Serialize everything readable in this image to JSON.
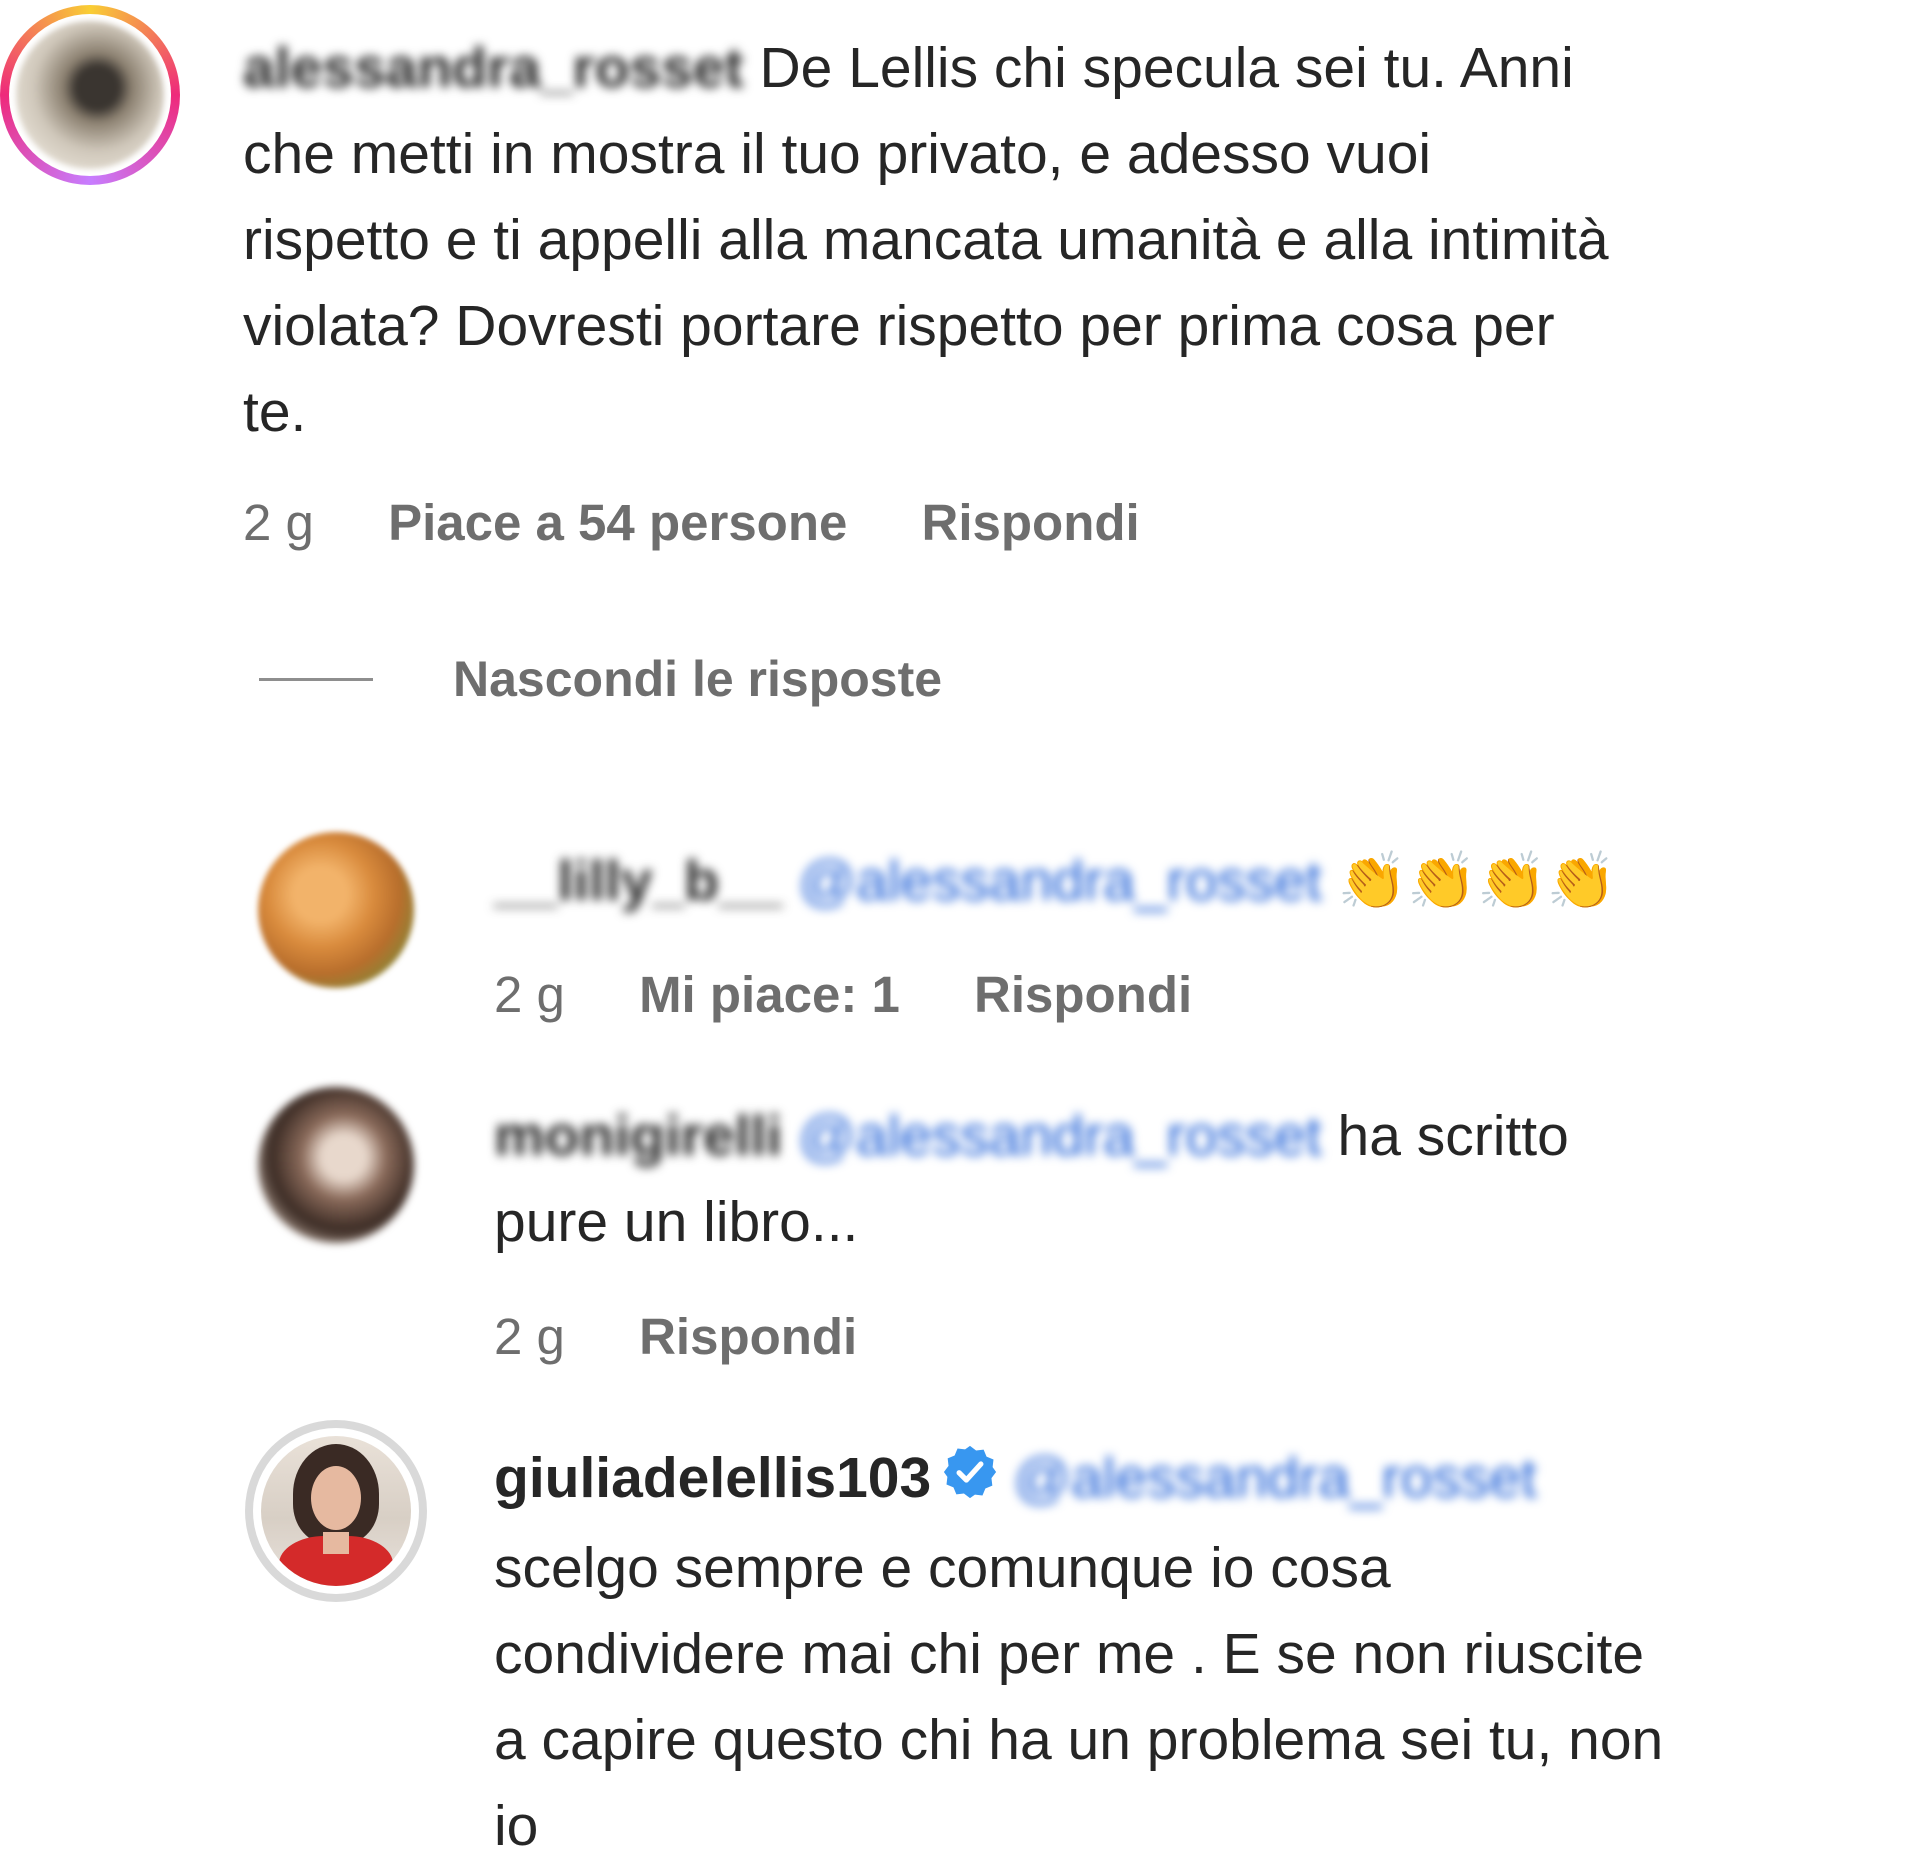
{
  "comment_main": {
    "username": "alessandra_rosset",
    "text_lines": [
      "De Lellis chi specula sei tu. Anni",
      "che metti in mostra il tuo privato, e adesso vuoi",
      "rispetto e ti appelli alla mancata umanità e alla intimità",
      "violata? Dovresti portare rispetto per prima cosa per",
      "te."
    ],
    "time": "2 g",
    "likes": "Piace a 54 persone",
    "reply_label": "Rispondi"
  },
  "replies_toggle": {
    "label": "Nascondi le risposte"
  },
  "reply1": {
    "username": "__lilly_b__",
    "mention": "@alessandra_rosset",
    "emoji": "👏👏👏👏",
    "time": "2 g",
    "likes": "Mi piace: 1",
    "reply_label": "Rispondi"
  },
  "reply2": {
    "username": "monigirelli",
    "mention": "@alessandra_rosset",
    "text_first": "ha scritto",
    "text_second": "pure un libro...",
    "time": "2 g",
    "reply_label": "Rispondi"
  },
  "reply3": {
    "username": "giuliadelellis103",
    "mention": "@alessandra_rosset",
    "text_lines": [
      "scelgo sempre e comunque io cosa",
      "condividere mai chi per me . E se non riuscite",
      "a capire questo chi ha un problema sei tu, non",
      "io"
    ]
  },
  "colors": {
    "text": "#262626",
    "meta": "#6e6e6e",
    "mention": "#1e5fd6",
    "verified": "#3897f0",
    "story_ring_start": "#f9ce34",
    "story_ring_end": "#ee2a7b"
  },
  "icons": {
    "verified": "verified-badge-icon",
    "clap": "clapping-hands-emoji"
  }
}
